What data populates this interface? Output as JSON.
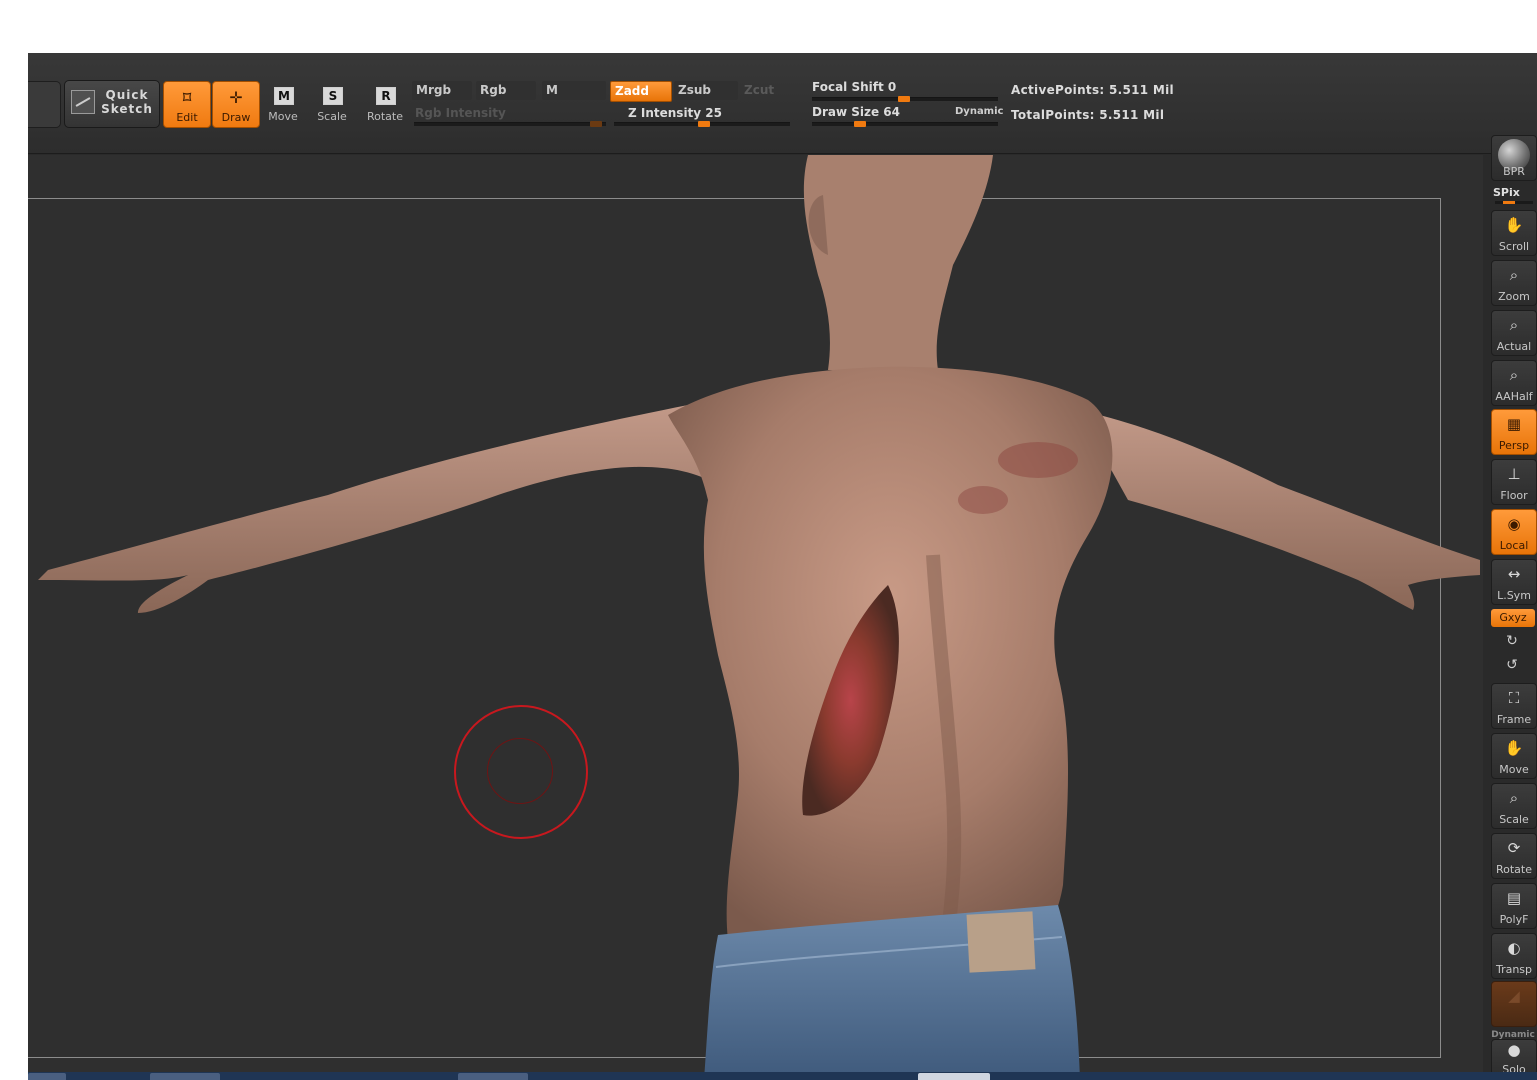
{
  "toolbar": {
    "quick_sketch_label": "Quick Sketch",
    "tools": [
      {
        "label": "Edit",
        "glyph": "⌑",
        "active": true
      },
      {
        "label": "Draw",
        "glyph": "✛",
        "active": true
      },
      {
        "label": "Move",
        "glyph": "M",
        "active": false
      },
      {
        "label": "Scale",
        "glyph": "S",
        "active": false
      },
      {
        "label": "Rotate",
        "glyph": "R",
        "active": false
      }
    ],
    "modes": {
      "mrgb": "Mrgb",
      "rgb": "Rgb",
      "m": "M",
      "zadd": "Zadd",
      "zsub": "Zsub",
      "zcut": "Zcut"
    },
    "rgb_intensity_label": "Rgb Intensity",
    "z_intensity_label": "Z Intensity 25",
    "z_intensity": 25,
    "focal_shift_label": "Focal Shift 0",
    "focal_shift": 0,
    "draw_size_label": "Draw Size 64",
    "draw_size": 64,
    "dynamic_label": "Dynamic",
    "active_points": "ActivePoints: 5.511  Mil",
    "total_points": "TotalPoints: 5.511  Mil"
  },
  "shelf": {
    "bpr": "BPR",
    "spix": "SPix",
    "buttons": [
      {
        "label": "Scroll",
        "icon": "hand-icon",
        "active": false
      },
      {
        "label": "Zoom",
        "icon": "magnifier-icon",
        "active": false
      },
      {
        "label": "Actual",
        "icon": "magnifier-icon",
        "active": false
      },
      {
        "label": "AAHalf",
        "icon": "magnifier-icon",
        "active": false
      },
      {
        "label": "Persp",
        "icon": "grid-icon",
        "active": true
      },
      {
        "label": "Floor",
        "icon": "floor-icon",
        "active": false
      },
      {
        "label": "Local",
        "icon": "local-icon",
        "active": true
      },
      {
        "label": "L.Sym",
        "icon": "symmetry-icon",
        "active": false
      }
    ],
    "xyz": "Gxyz",
    "buttons2": [
      {
        "label": "Frame",
        "icon": "frame-icon",
        "active": false
      },
      {
        "label": "Move",
        "icon": "hand-icon",
        "active": false
      },
      {
        "label": "Scale",
        "icon": "magnifier-icon",
        "active": false
      },
      {
        "label": "Rotate",
        "icon": "rotate-icon",
        "active": false
      },
      {
        "label": "PolyF",
        "icon": "polyframe-icon",
        "active": false
      },
      {
        "label": "Transp",
        "icon": "transparency-icon",
        "active": false
      }
    ],
    "dynamic": "Dynamic",
    "solo": "Solo"
  },
  "colors": {
    "accent": "#f07a10",
    "background": "#2f2f2f",
    "brush_ring": "#c8181e"
  }
}
